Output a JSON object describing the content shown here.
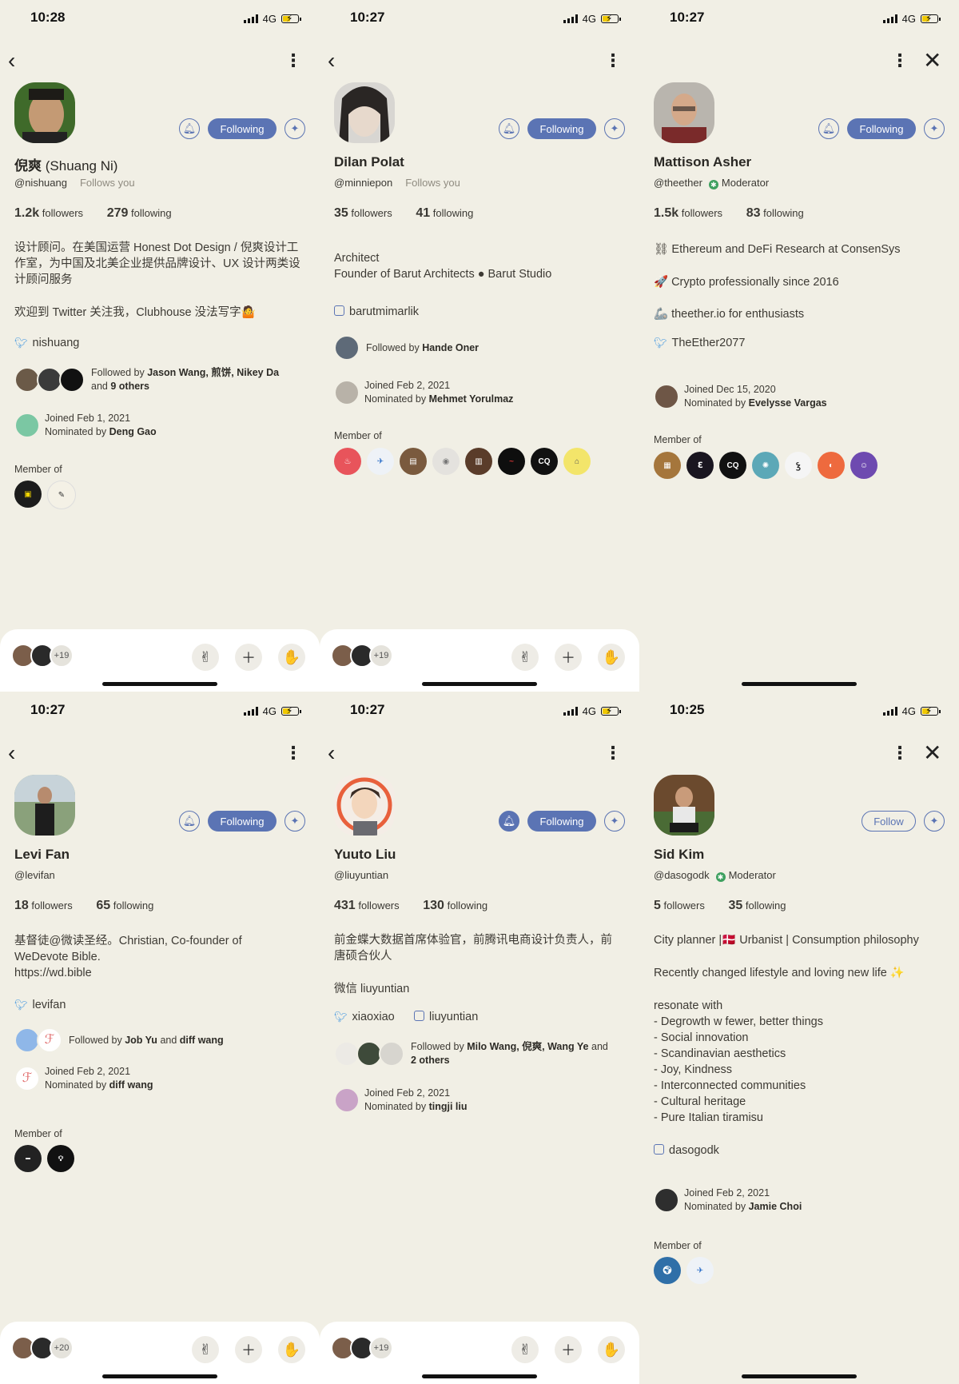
{
  "status": {
    "network": "4G"
  },
  "screens": [
    {
      "time": "10:28",
      "name": "倪爽",
      "alt_name": "(Shuang Ni)",
      "handle": "@nishuang",
      "follows_you": "Follows you",
      "followers_count": "1.2k",
      "followers_label": "followers",
      "following_count": "279",
      "following_label": "following",
      "follow_label": "Following",
      "bio1": "设计顾问。在美国运营 Honest Dot Design / 倪爽设计工作室，为中国及北美企业提供品牌设计、UX 设计两类设计顾问服务",
      "bio2": "欢迎到 Twitter 关注我，Clubhouse 没法写字🤷",
      "twitter": "nishuang",
      "followed_by_prefix": "Followed by",
      "followed_by_names": "Jason Wang, 煎饼, Nikey Da",
      "followed_by_and": "and",
      "followed_by_others": "9 others",
      "joined": "Joined Feb 1, 2021",
      "nominated_prefix": "Nominated by",
      "nominated_by": "Deng Gao",
      "member_of": "Member of",
      "bottom_count": "+19"
    },
    {
      "time": "10:27",
      "name": "Dilan Polat",
      "handle": "@minniepon",
      "follows_you": "Follows you",
      "followers_count": "35",
      "followers_label": "followers",
      "following_count": "41",
      "following_label": "following",
      "follow_label": "Following",
      "bio1": "Architect\nFounder of Barut Architects ● Barut Studio",
      "instagram": "barutmimarlik",
      "followed_by_prefix": "Followed by",
      "followed_by_names": "Hande Oner",
      "joined": "Joined Feb 2, 2021",
      "nominated_prefix": "Nominated by",
      "nominated_by": "Mehmet Yorulmaz",
      "member_of": "Member of",
      "club_cq": "CQ",
      "bottom_count": "+19"
    },
    {
      "time": "10:27",
      "name": "Mattison Asher",
      "handle": "@theether",
      "moderator": "Moderator",
      "followers_count": "1.5k",
      "followers_label": "followers",
      "following_count": "83",
      "following_label": "following",
      "follow_label": "Following",
      "bio1": "⛓ Ethereum and DeFi Research at ConsenSys",
      "bio2": "🚀 Crypto professionally since 2016",
      "bio3": "🦾 theether.io for enthusiasts",
      "twitter": "TheEther2077",
      "joined": "Joined Dec 15, 2020",
      "nominated_prefix": "Nominated by",
      "nominated_by": "Evelysse Vargas",
      "member_of": "Member of",
      "club_cq": "CQ"
    },
    {
      "time": "10:27",
      "name": "Levi Fan",
      "handle": "@levifan",
      "followers_count": "18",
      "followers_label": "followers",
      "following_count": "65",
      "following_label": "following",
      "follow_label": "Following",
      "bio1": "基督徒@微读圣经。Christian, Co-founder of WeDevote Bible.\nhttps://wd.bible",
      "twitter": "levifan",
      "followed_by_prefix": "Followed by",
      "followed_by_names": "Job Yu",
      "followed_by_and": "and",
      "followed_by_others": "diff wang",
      "joined": "Joined Feb 2, 2021",
      "nominated_prefix": "Nominated by",
      "nominated_by": "diff wang",
      "member_of": "Member of",
      "bottom_count": "+20"
    },
    {
      "time": "10:27",
      "name": "Yuuto Liu",
      "handle": "@liuyuntian",
      "followers_count": "431",
      "followers_label": "followers",
      "following_count": "130",
      "following_label": "following",
      "follow_label": "Following",
      "bio1": "前金蝶大数据首席体验官，前腾讯电商设计负责人，前唐硕合伙人",
      "bio2": "微信 liuyuntian",
      "twitter": "xiaoxiao",
      "instagram": "liuyuntian",
      "followed_by_prefix": "Followed by",
      "followed_by_names": "Milo Wang, 倪爽, Wang Ye",
      "followed_by_and": "and",
      "followed_by_others": "2 others",
      "joined": "Joined Feb 2, 2021",
      "nominated_prefix": "Nominated by",
      "nominated_by": "tingji liu",
      "bottom_count": "+19"
    },
    {
      "time": "10:25",
      "name": "Sid Kim",
      "handle": "@dasogodk",
      "moderator": "Moderator",
      "followers_count": "5",
      "followers_label": "followers",
      "following_count": "35",
      "following_label": "following",
      "follow_label": "Follow",
      "bio1": "City planner |🇩🇰 Urbanist | Consumption philosophy",
      "bio2": "Recently changed lifestyle and loving new life ✨",
      "bio3": "resonate with\n- Degrowth w fewer, better things\n- Social innovation\n- Scandinavian aesthetics\n- Joy, Kindness\n- Interconnected communities\n- Cultural heritage\n- Pure Italian tiramisu",
      "instagram": "dasogodk",
      "joined": "Joined Feb 2, 2021",
      "nominated_prefix": "Nominated by",
      "nominated_by": "Jamie Choi",
      "member_of": "Member of"
    }
  ],
  "icons": {
    "back": "chevron-left-icon",
    "more": "more-vertical-icon",
    "close": "close-icon",
    "bell": "bell-icon",
    "spark": "sparkle-add-icon",
    "peace": "peace-hand-icon",
    "plus": "plus-icon",
    "raise": "raise-hand-icon"
  },
  "colors": {
    "accent": "#5b74b4",
    "background": "#f1efe5",
    "twitter": "#4a9be0",
    "moderator": "#3da05f"
  }
}
